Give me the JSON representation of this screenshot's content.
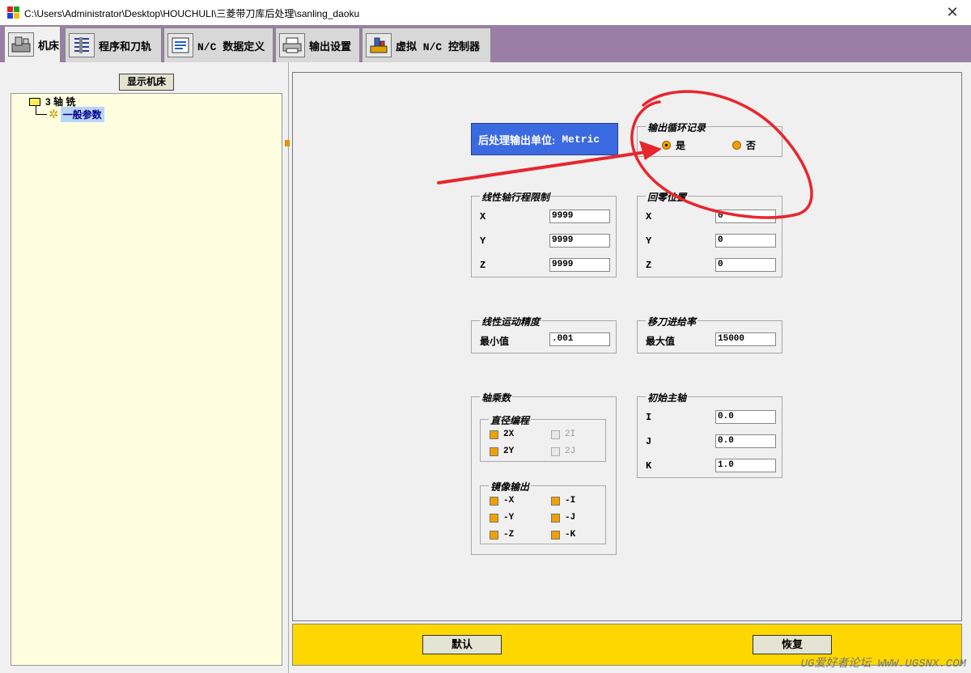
{
  "window": {
    "title": "C:\\Users\\Administrator\\Desktop\\HOUCHULI\\三菱带刀库后处理\\sanling_daoku",
    "close_glyph": "✕"
  },
  "tabs": [
    {
      "label": "机床",
      "icon": "machine-icon",
      "active": true
    },
    {
      "label": "程序和刀轨",
      "icon": "program-icon",
      "active": false
    },
    {
      "label": "N/C 数据定义",
      "icon": "nc-data-icon",
      "active": false
    },
    {
      "label": "输出设置",
      "icon": "printer-icon",
      "active": false
    },
    {
      "label": "虚拟 N/C 控制器",
      "icon": "vnc-icon",
      "active": false
    }
  ],
  "left_panel": {
    "show_machine_button": "显示机床",
    "tree": {
      "root": "3 轴 铣",
      "child": "一般参数"
    }
  },
  "main": {
    "unit_box": {
      "label": "后处理输出单位:",
      "value": "Metric"
    },
    "cycle_output": {
      "title": "输出循环记录",
      "options": [
        {
          "label": "是",
          "selected": true
        },
        {
          "label": "否",
          "selected": false
        }
      ]
    },
    "linear_travel": {
      "title": "线性轴行程限制",
      "rows": [
        {
          "label": "X",
          "value": "9999"
        },
        {
          "label": "Y",
          "value": "9999"
        },
        {
          "label": "Z",
          "value": "9999"
        }
      ]
    },
    "home_position": {
      "title": "回零位置",
      "rows": [
        {
          "label": "X",
          "value": "0"
        },
        {
          "label": "Y",
          "value": "0"
        },
        {
          "label": "Z",
          "value": "0"
        }
      ]
    },
    "linear_precision": {
      "title": "线性运动精度",
      "label": "最小值",
      "value": ".001"
    },
    "traverse_feed": {
      "title": "移刀进给率",
      "label": "最大值",
      "value": "15000"
    },
    "axis_multiplier": {
      "title": "轴乘数",
      "diameter": {
        "title": "直径编程",
        "items": [
          {
            "label": "2X",
            "checked": true,
            "enabled": true
          },
          {
            "label": "2I",
            "checked": false,
            "enabled": false
          },
          {
            "label": "2Y",
            "checked": true,
            "enabled": true
          },
          {
            "label": "2J",
            "checked": false,
            "enabled": false
          }
        ]
      },
      "mirror": {
        "title": "镜像输出",
        "items": [
          {
            "label": "-X",
            "checked": true
          },
          {
            "label": "-I",
            "checked": true
          },
          {
            "label": "-Y",
            "checked": true
          },
          {
            "label": "-J",
            "checked": true
          },
          {
            "label": "-Z",
            "checked": true
          },
          {
            "label": "-K",
            "checked": true
          }
        ]
      }
    },
    "initial_spindle": {
      "title": "初始主轴",
      "rows": [
        {
          "label": "I",
          "value": "0.0"
        },
        {
          "label": "J",
          "value": "0.0"
        },
        {
          "label": "K",
          "value": "1.0"
        }
      ]
    }
  },
  "bottom": {
    "default_button": "默认",
    "restore_button": "恢复"
  },
  "watermark": "UG爱好者论坛 WWW.UGSNX.COM",
  "colors": {
    "tabbar": "#9b7ea6",
    "unit_box": "#3b6ae0",
    "bottom_bar": "#ffd700",
    "tree_bg": "#fffde0",
    "annotation": "#e8262e"
  }
}
